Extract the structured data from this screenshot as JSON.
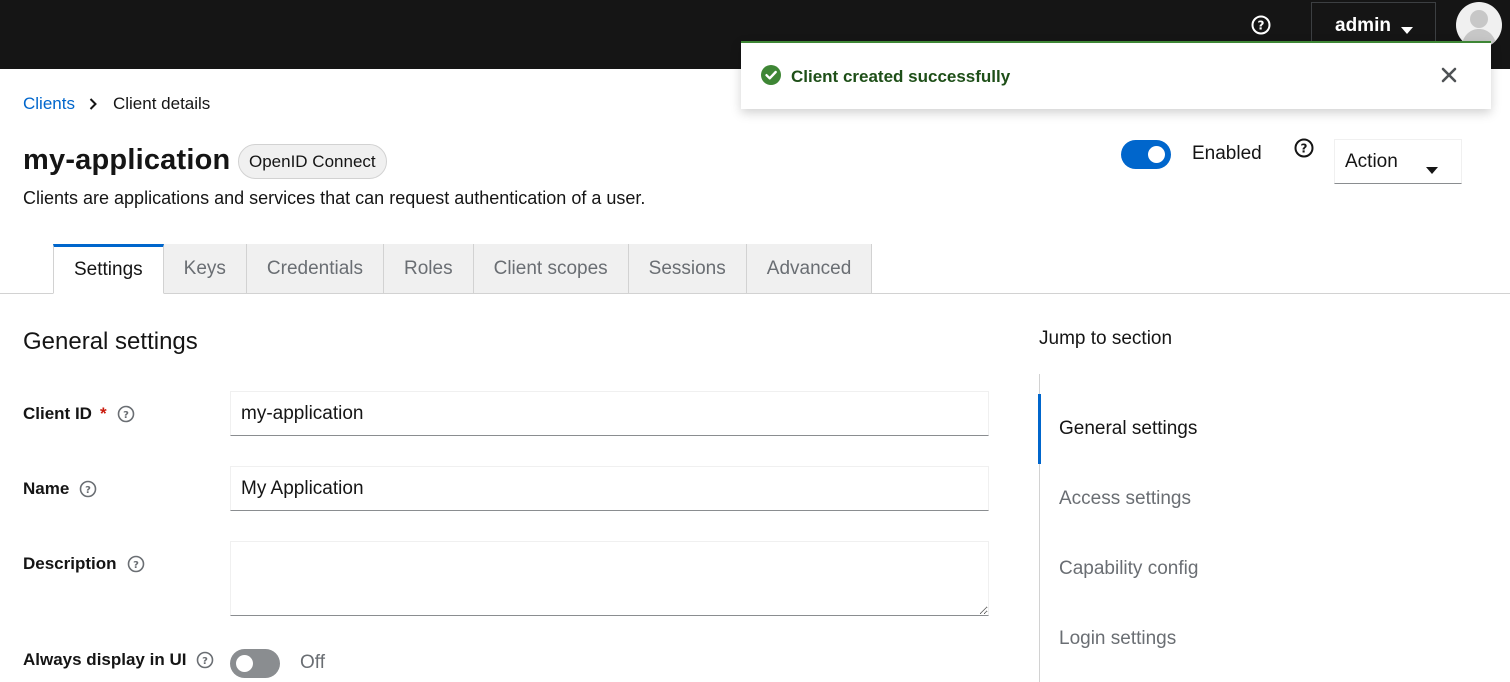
{
  "header": {
    "help_icon": "question-circle-icon",
    "user_menu_label": "admin",
    "avatar_icon": "user-avatar-icon"
  },
  "toast": {
    "message": "Client created successfully",
    "status_color": "#3e8635",
    "icon": "check-circle-icon",
    "close_icon": "close-icon"
  },
  "breadcrumb": {
    "parent": "Clients",
    "current": "Client details"
  },
  "page": {
    "title": "my-application",
    "protocol_badge": "OpenID Connect",
    "description": "Clients are applications and services that can request authentication of a user.",
    "enabled_label": "Enabled",
    "enabled": true,
    "action_label": "Action"
  },
  "tabs": [
    {
      "label": "Settings",
      "active": true
    },
    {
      "label": "Keys",
      "active": false
    },
    {
      "label": "Credentials",
      "active": false
    },
    {
      "label": "Roles",
      "active": false
    },
    {
      "label": "Client scopes",
      "active": false
    },
    {
      "label": "Sessions",
      "active": false
    },
    {
      "label": "Advanced",
      "active": false
    }
  ],
  "form": {
    "section_title": "General settings",
    "client_id": {
      "label": "Client ID",
      "required_mark": "*",
      "value": "my-application"
    },
    "name": {
      "label": "Name",
      "value": "My Application"
    },
    "description": {
      "label": "Description",
      "value": ""
    },
    "always_display": {
      "label": "Always display in UI",
      "state_label": "Off",
      "enabled": false
    }
  },
  "jump": {
    "title": "Jump to section",
    "items": [
      {
        "label": "General settings",
        "active": true
      },
      {
        "label": "Access settings",
        "active": false
      },
      {
        "label": "Capability config",
        "active": false
      },
      {
        "label": "Login settings",
        "active": false
      }
    ]
  },
  "colors": {
    "accent": "#0066cc",
    "topbar": "#151515",
    "success": "#3e8635",
    "required": "#c9190b"
  }
}
